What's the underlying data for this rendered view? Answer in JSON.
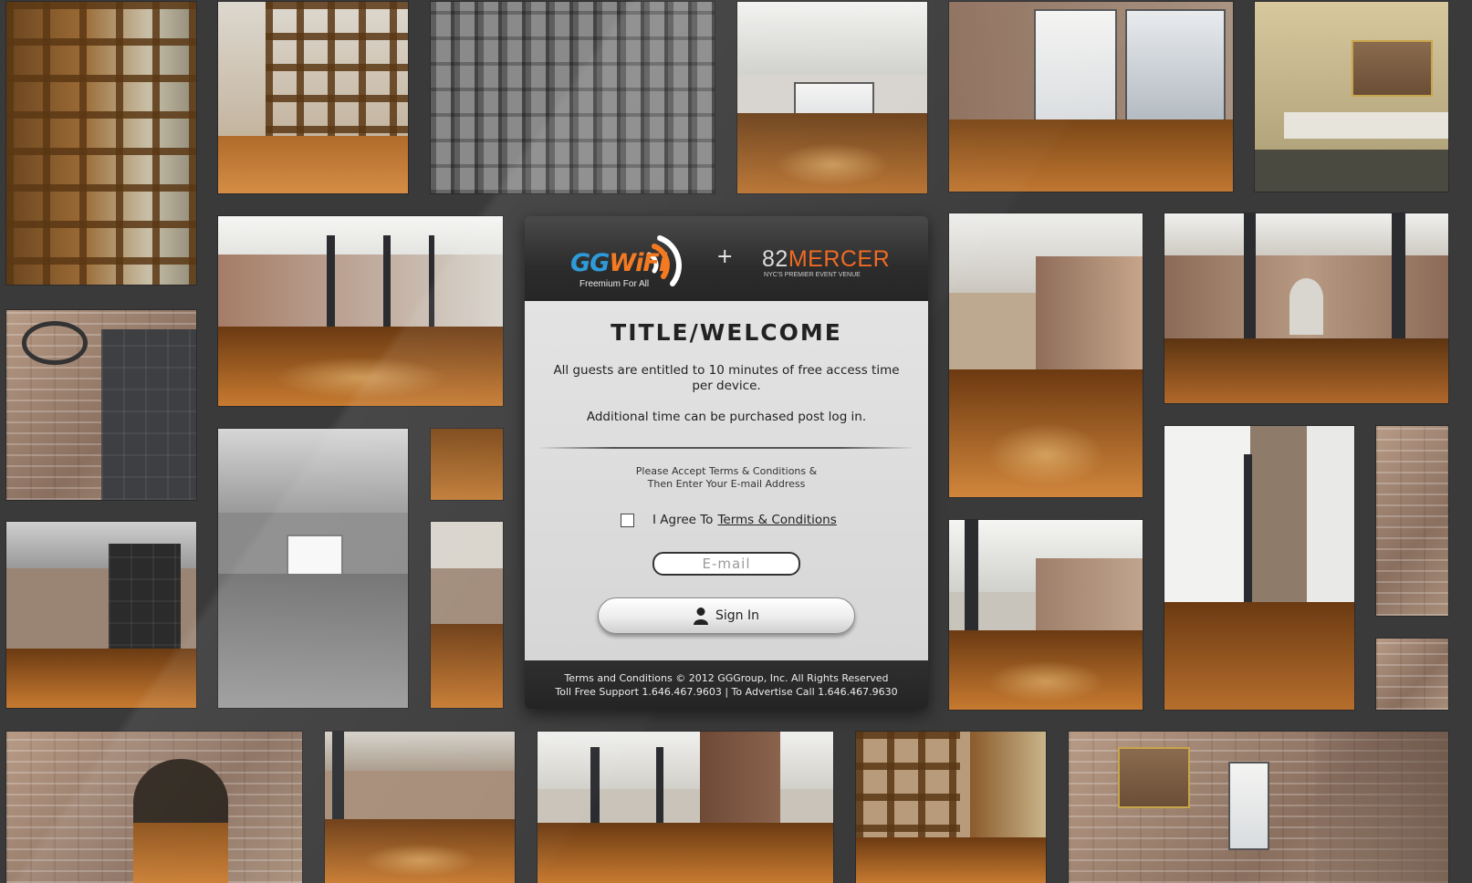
{
  "header": {
    "gg_brand_part1": "GG",
    "gg_brand_part2": "WiFi",
    "gg_tagline": "Freemium For All",
    "plus": "+",
    "mercer_number": "82",
    "mercer_name": "MERCER",
    "mercer_tagline": "NYC'S PREMIER EVENT VENUE"
  },
  "main": {
    "title": "TITLE/WELCOME",
    "intro_line_1": "All guests are entitled to 10 minutes of free access time per device.",
    "intro_line_2": "Additional time can be purchased post log in.",
    "terms_instruction_1": "Please Accept Terms & Conditions &",
    "terms_instruction_2": "Then Enter Your E-mail Address",
    "agree_label": "I Agree To",
    "terms_link": "Terms & Conditions",
    "agree_checked": false,
    "email_placeholder": "E-mail",
    "sign_in_label": "Sign In"
  },
  "footer": {
    "line_1": "Terms and Conditions © 2012 GGGroup, Inc. All Rights Reserved",
    "line_2": "Toll Free Support 1.646.467.9603 | To Advertise Call 1.646.467.9630"
  },
  "colors": {
    "background": "#3a3a3b",
    "gg_blue": "#2f9ad8",
    "brand_orange": "#f47a22",
    "panel_dark": "#2b2b2b",
    "panel_light": "#e0e0e0"
  },
  "icons": [
    "wifi-arc-icon",
    "user-icon",
    "checkbox-icon"
  ],
  "background_photos": [
    "Wooden shelving wall",
    "Wooden lattice partition",
    "Building exterior with fire escapes",
    "Loft with windows and wood floor",
    "Loft with large street windows",
    "Restroom vanity with mirrors",
    "Loft with columns and wood floor",
    "Barn door track closeup",
    "Gray loft corridor",
    "Brick hallway with wood floor",
    "Hallway with sliding door",
    "Long loft with lights",
    "Brick wall with column",
    "Doorway in brick loft",
    "Brick wall texture",
    "Brick archway",
    "Loft columns",
    "Loft with column",
    "Wooden lattice view",
    "Brick wall with mirror and window"
  ]
}
